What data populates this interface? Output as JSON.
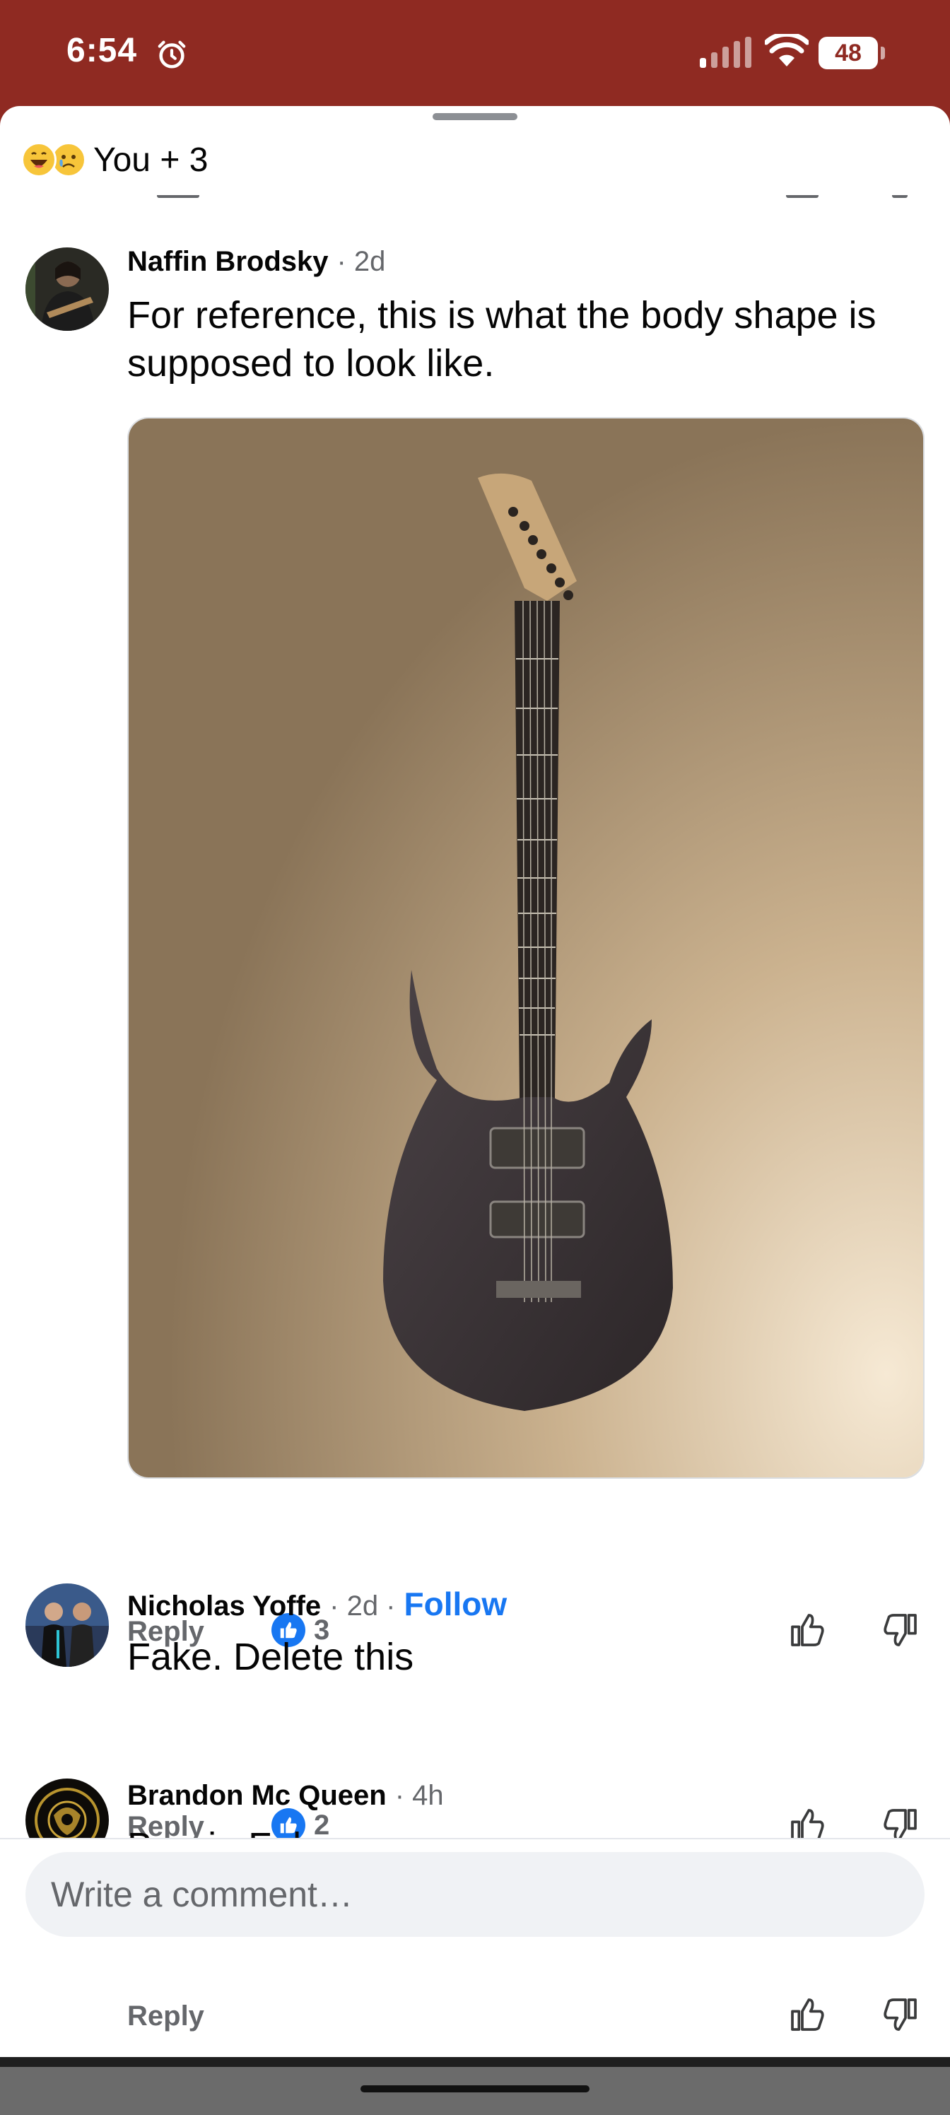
{
  "status_bar": {
    "time": "6:54",
    "battery": "48"
  },
  "sheet": {
    "reactions_text": "You + 3"
  },
  "comments": [
    {
      "name": "Naffin Brodsky",
      "meta": "· 2d",
      "text": "For reference, this is what the body shape is supposed to look like.",
      "reply_label": "Reply",
      "likes": "3"
    },
    {
      "name": "Nicholas Yoffe",
      "meta": "· 2d ·",
      "follow_label": "Follow",
      "text": "Fake. Delete this",
      "reply_label": "Reply",
      "likes": "2"
    },
    {
      "name": "Brandon Mc Queen",
      "meta": "· 4h",
      "text": "Bernie Fako",
      "reply_label": "Reply"
    }
  ],
  "composer": {
    "placeholder": "Write a comment…"
  },
  "colors": {
    "brand_blue": "#1877f2",
    "status_bar_bg": "#8f2a22",
    "meta_gray": "#65676b"
  },
  "icons": [
    "alarm-icon",
    "signal-icon",
    "wifi-icon",
    "like-badge-icon",
    "thumb-up-icon",
    "thumb-down-icon"
  ]
}
